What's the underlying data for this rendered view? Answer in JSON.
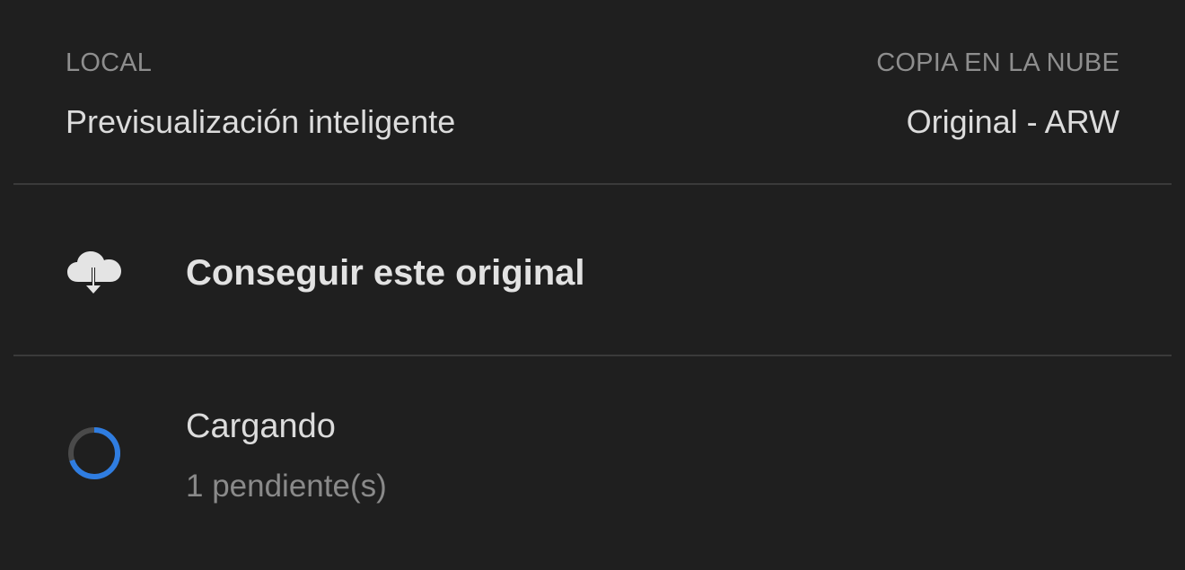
{
  "storage": {
    "local": {
      "heading": "LOCAL",
      "value": "Previsualización inteligente"
    },
    "cloud": {
      "heading": "COPIA EN LA NUBE",
      "value": "Original - ARW"
    }
  },
  "action": {
    "icon": "cloud-download-icon",
    "label": "Conseguir este original"
  },
  "status": {
    "icon": "loading-spinner-icon",
    "title": "Cargando",
    "subtitle": "1 pendiente(s)",
    "progress_fraction": 0.7,
    "accent_color": "#2f7de1"
  },
  "colors": {
    "background": "#1f1f1f",
    "divider": "#3a3a3a",
    "primary_text": "#dcdcdc",
    "secondary_text": "#8e8e8e"
  }
}
